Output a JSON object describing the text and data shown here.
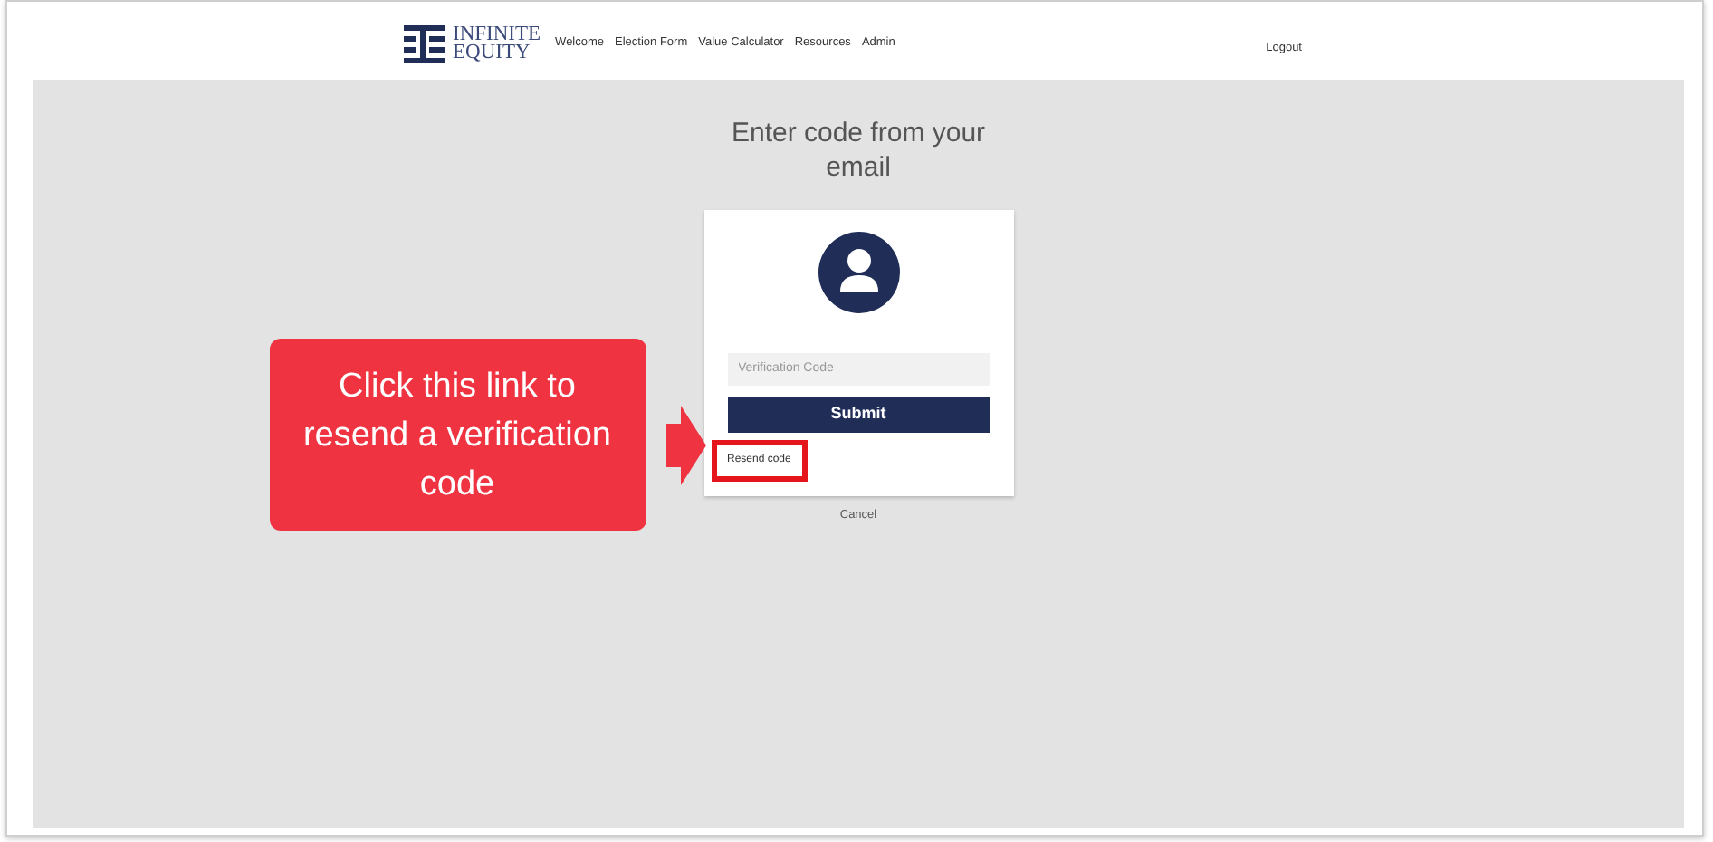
{
  "brand": {
    "lines": [
      "INFINITE",
      "EQUITY"
    ]
  },
  "nav": {
    "links": [
      {
        "label": "Welcome"
      },
      {
        "label": "Election Form"
      },
      {
        "label": "Value Calculator"
      },
      {
        "label": "Resources"
      },
      {
        "label": "Admin"
      }
    ],
    "logout": "Logout"
  },
  "heading": "Enter code from your email",
  "form": {
    "placeholder": "Verification Code",
    "submit": "Submit",
    "resend": {
      "label": "Resend code",
      "highlighted": true
    },
    "cancel": "Cancel"
  },
  "callout": {
    "text": "Click this link to resend a verification code"
  }
}
